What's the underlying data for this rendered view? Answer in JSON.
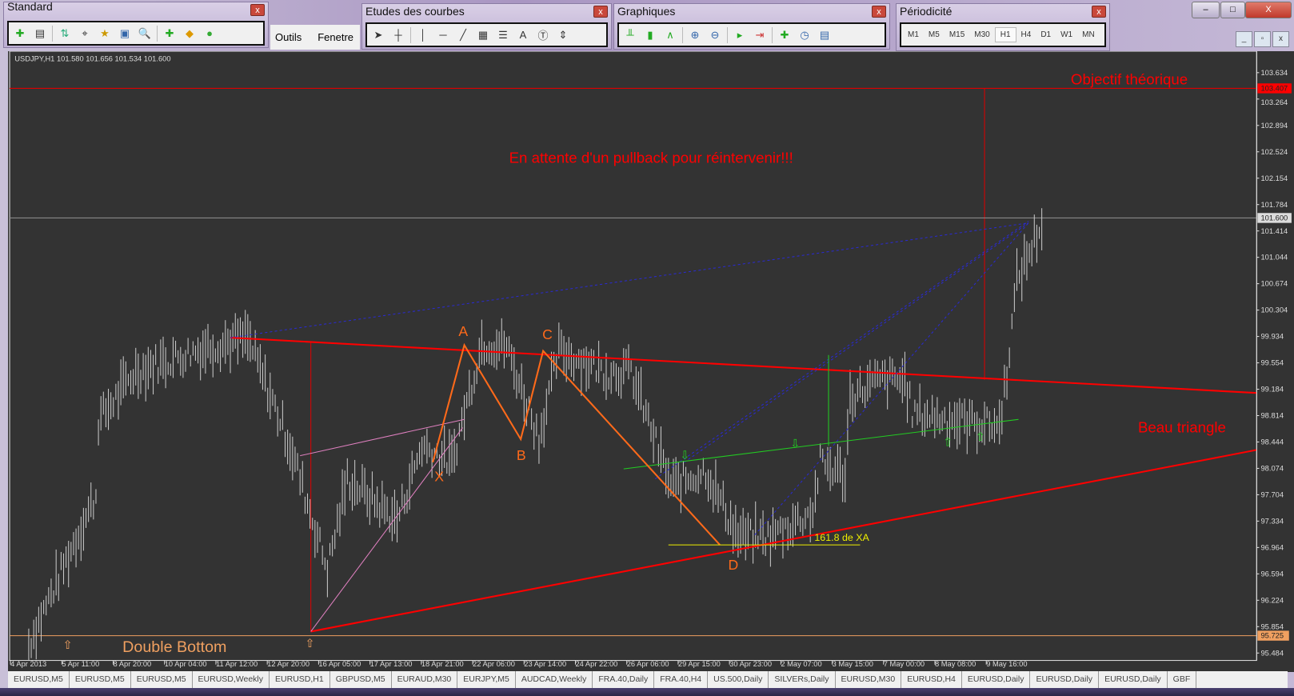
{
  "toolbars": {
    "standard": {
      "title": "Standard",
      "close": "x"
    },
    "menu": [
      "Outils",
      "Fenetre"
    ],
    "studies": {
      "title": "Etudes des courbes",
      "close": "x",
      "text_tool": "A"
    },
    "charts": {
      "title": "Graphiques",
      "close": "x"
    },
    "periods": {
      "title": "Périodicité",
      "close": "x",
      "items": [
        "M1",
        "M5",
        "M15",
        "M30",
        "H1",
        "H4",
        "D1",
        "W1",
        "MN"
      ],
      "selected": "H1"
    }
  },
  "window_controls": {
    "minimize": "–",
    "maximize": "□",
    "close": "X"
  },
  "chart": {
    "header": "USDJPY,H1  101.580 101.656 101.534 101.600",
    "current_price": "101.600",
    "target_price": "103.407",
    "support_price": "95.725",
    "price_ticks": [
      "103.634",
      "103.264",
      "102.894",
      "102.524",
      "102.154",
      "101.784",
      "101.414",
      "101.044",
      "100.674",
      "100.304",
      "99.934",
      "99.554",
      "99.184",
      "98.814",
      "98.444",
      "98.074",
      "97.704",
      "97.334",
      "96.964",
      "96.594",
      "96.224",
      "95.854",
      "95.484"
    ],
    "time_ticks": [
      "4 Apr 2013",
      "5 Apr 11:00",
      "8 Apr 20:00",
      "10 Apr 04:00",
      "11 Apr 12:00",
      "12 Apr 20:00",
      "16 Apr 05:00",
      "17 Apr 13:00",
      "18 Apr 21:00",
      "22 Apr 06:00",
      "23 Apr 14:00",
      "24 Apr 22:00",
      "26 Apr 06:00",
      "29 Apr 15:00",
      "30 Apr 23:00",
      "2 May 07:00",
      "3 May 15:00",
      "7 May 00:00",
      "8 May 08:00",
      "9 May 16:00"
    ],
    "annotations": {
      "objective": "Objectif théorique",
      "pullback": "En attente d'un pullback pour réintervenir!!!",
      "triangle": "Beau triangle",
      "double_bottom": "Double Bottom",
      "fib": "161.8 de XA",
      "A": "A",
      "B": "B",
      "C": "C",
      "D": "D",
      "X": "X"
    },
    "colors": {
      "background": "#333333",
      "bars": "#c8c8c8",
      "annotation": "#ff0000",
      "pattern": "#ff6a1a",
      "support": "#f0a060"
    }
  },
  "chart_data": {
    "type": "line",
    "title": "USDJPY,H1",
    "ylim": [
      95.484,
      103.634
    ],
    "x_unit": "bar index",
    "points": [
      [
        0,
        95.61
      ],
      [
        27,
        97.7
      ],
      [
        28,
        98.74
      ],
      [
        43,
        99.44
      ],
      [
        72,
        99.79
      ],
      [
        88,
        99.9
      ],
      [
        105,
        98.4
      ],
      [
        120,
        96.66
      ],
      [
        128,
        97.93
      ],
      [
        148,
        97.35
      ],
      [
        158,
        98.4
      ],
      [
        170,
        98.16
      ],
      [
        182,
        99.84
      ],
      [
        192,
        99.79
      ],
      [
        205,
        98.51
      ],
      [
        213,
        99.73
      ],
      [
        232,
        99.44
      ],
      [
        242,
        99.44
      ],
      [
        258,
        97.82
      ],
      [
        272,
        98.05
      ],
      [
        285,
        97.12
      ],
      [
        298,
        97.12
      ],
      [
        315,
        97.47
      ],
      [
        318,
        98.16
      ],
      [
        328,
        97.99
      ],
      [
        330,
        99.09
      ],
      [
        342,
        99.32
      ],
      [
        352,
        99.32
      ],
      [
        355,
        98.86
      ],
      [
        375,
        98.74
      ],
      [
        390,
        98.68
      ],
      [
        393,
        99.44
      ],
      [
        397,
        100.71
      ],
      [
        408,
        101.6
      ]
    ]
  },
  "tabs": [
    "EURUSD,M5",
    "EURUSD,M5",
    "EURUSD,M5",
    "EURUSD,Weekly",
    "EURUSD,H1",
    "GBPUSD,M5",
    "EURAUD,M30",
    "EURJPY,M5",
    "AUDCAD,Weekly",
    "FRA.40,Daily",
    "FRA.40,H4",
    "US.500,Daily",
    "SILVERs,Daily",
    "EURUSD,M30",
    "EURUSD,H4",
    "EURUSD,Daily",
    "EURUSD,Daily",
    "EURUSD,Daily",
    "GBF"
  ]
}
